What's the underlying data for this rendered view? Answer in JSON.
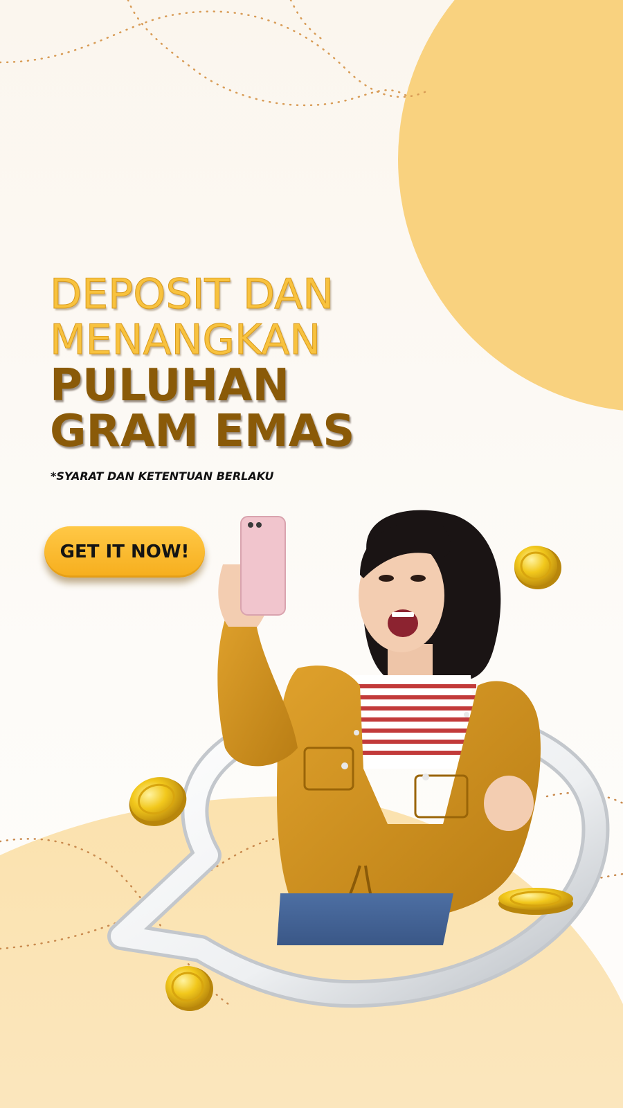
{
  "promo": {
    "headline_line_1": "DEPOSIT DAN",
    "headline_line_2": "MENANGKAN",
    "headline_line_3": "PULUHAN",
    "headline_line_4": "GRAM EMAS",
    "terms_note": "*SYARAT DAN KETENTUAN BERLAKU",
    "cta_label": "GET IT NOW!"
  },
  "colors": {
    "background": "#fbf7f0",
    "accent_light_gold": "#f8c23e",
    "accent_dark_gold": "#8a5a08",
    "cta_yellow": "#ffc846",
    "blob_yellow": "#f9d27f",
    "jacket_mustard": "#d1921f",
    "coin_gold": "#e8b710"
  },
  "icons": [
    "gold-coin-icon",
    "chat-bubble-icon",
    "smartphone-icon"
  ]
}
